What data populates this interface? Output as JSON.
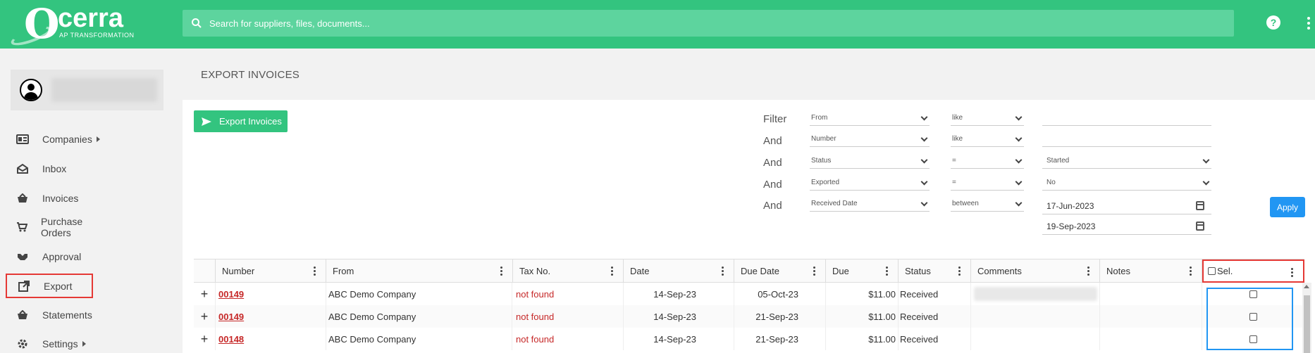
{
  "brand": {
    "name": "cerra",
    "logo_letter": "O",
    "tagline": "AP TRANSFORMATION"
  },
  "search": {
    "placeholder": "Search for suppliers, files, documents..."
  },
  "header_icons": {
    "help": "?",
    "more": "more-vertical-icon"
  },
  "sidebar": {
    "items": [
      {
        "label": "Companies",
        "icon": "id-card-icon",
        "has_submenu": true
      },
      {
        "label": "Inbox",
        "icon": "envelope-open-icon"
      },
      {
        "label": "Invoices",
        "icon": "basket-icon"
      },
      {
        "label": "Purchase Orders",
        "icon": "cart-icon"
      },
      {
        "label": "Approval",
        "icon": "handshake-icon"
      },
      {
        "label": "Export",
        "icon": "external-link-icon",
        "active": true
      },
      {
        "label": "Statements",
        "icon": "basket-icon"
      },
      {
        "label": "Settings",
        "icon": "gear-icon",
        "has_submenu": true
      }
    ]
  },
  "page": {
    "title": "EXPORT INVOICES",
    "export_button": "Export Invoices",
    "apply_button": "Apply"
  },
  "filters": [
    {
      "connector": "Filter",
      "field": "From",
      "operator": "like",
      "value": ""
    },
    {
      "connector": "And",
      "field": "Number",
      "operator": "like",
      "value": ""
    },
    {
      "connector": "And",
      "field": "Status",
      "operator": "=",
      "value": "Started"
    },
    {
      "connector": "And",
      "field": "Exported",
      "operator": "=",
      "value": "No"
    },
    {
      "connector": "And",
      "field": "Received Date",
      "operator": "between",
      "value": "17-Jun-2023",
      "value2": "19-Sep-2023"
    }
  ],
  "table": {
    "columns": [
      "Number",
      "From",
      "Tax No.",
      "Date",
      "Due Date",
      "Due",
      "Status",
      "Comments",
      "Notes",
      "Sel."
    ],
    "rows": [
      {
        "expand": "+",
        "number": "00149",
        "from": "ABC Demo Company",
        "tax_no": "not found",
        "date": "14-Sep-23",
        "due_date": "05-Oct-23",
        "due": "$11.00",
        "status": "Received"
      },
      {
        "expand": "+",
        "number": "00149",
        "from": "ABC Demo Company",
        "tax_no": "not found",
        "date": "14-Sep-23",
        "due_date": "21-Sep-23",
        "due": "$11.00",
        "status": "Received"
      },
      {
        "expand": "+",
        "number": "00148",
        "from": "ABC Demo Company",
        "tax_no": "not found",
        "date": "14-Sep-23",
        "due_date": "21-Sep-23",
        "due": "$11.00",
        "status": "Received"
      }
    ]
  },
  "colors": {
    "brand_green": "#33c47f",
    "apply_blue": "#2196f3",
    "link_red": "#c62828",
    "highlight_red": "#e53935"
  }
}
